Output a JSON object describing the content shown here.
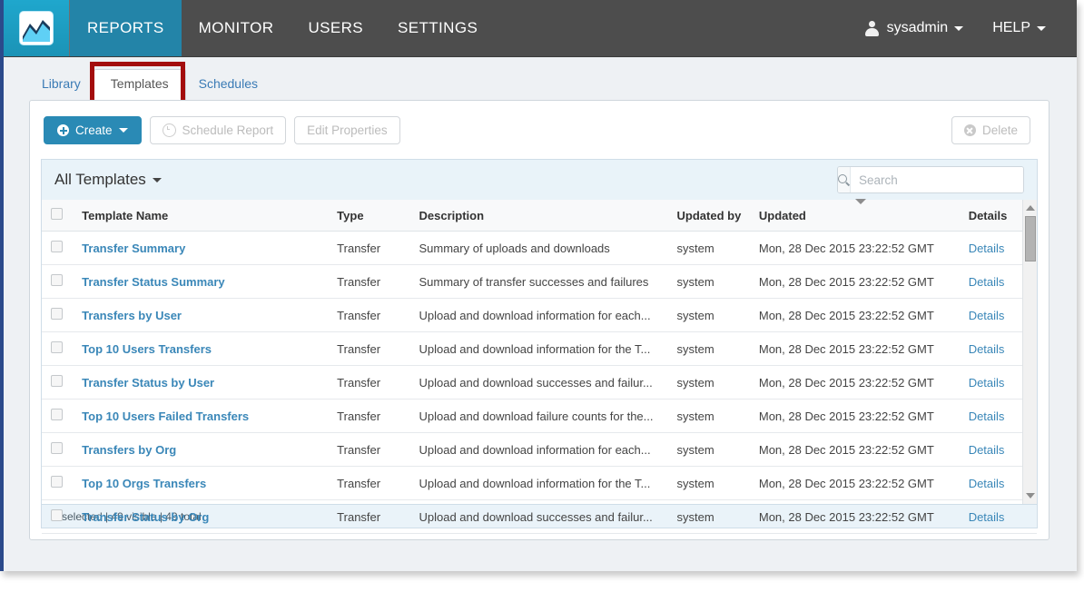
{
  "topnav": {
    "logo_icon": "chart-logo-icon",
    "items": [
      {
        "label": "REPORTS",
        "active": true
      },
      {
        "label": "MONITOR",
        "active": false
      },
      {
        "label": "USERS",
        "active": false
      },
      {
        "label": "SETTINGS",
        "active": false
      }
    ],
    "user": {
      "label": "sysadmin",
      "icon": "user-icon"
    },
    "help": {
      "label": "HELP"
    },
    "active_color": "#2384a8",
    "bar_color": "#4d4d4d"
  },
  "subtabs": {
    "items": [
      {
        "label": "Library",
        "active": false
      },
      {
        "label": "Templates",
        "active": true
      },
      {
        "label": "Schedules",
        "active": false
      }
    ],
    "annotation_color": "#a30d0d"
  },
  "toolbar": {
    "create_label": "Create",
    "schedule_report_label": "Schedule Report",
    "edit_properties_label": "Edit Properties",
    "delete_label": "Delete",
    "primary_color": "#2a8ab5"
  },
  "list_header": {
    "title": "All Templates",
    "search_placeholder": "Search",
    "search_value": ""
  },
  "table": {
    "columns": [
      "Template Name",
      "Type",
      "Description",
      "Updated by",
      "Updated",
      "Details"
    ],
    "sorted_column": "Updated",
    "details_label": "Details",
    "rows": [
      {
        "name": "Transfer Summary",
        "type": "Transfer",
        "description": "Summary of uploads and downloads",
        "updated_by": "system",
        "updated": "Mon, 28 Dec 2015 23:22:52 GMT",
        "details": "Details"
      },
      {
        "name": "Transfer Status Summary",
        "type": "Transfer",
        "description": "Summary of transfer successes and failures",
        "updated_by": "system",
        "updated": "Mon, 28 Dec 2015 23:22:52 GMT",
        "details": "Details"
      },
      {
        "name": "Transfers by User",
        "type": "Transfer",
        "description": "Upload and download information for each...",
        "updated_by": "system",
        "updated": "Mon, 28 Dec 2015 23:22:52 GMT",
        "details": "Details"
      },
      {
        "name": "Top 10 Users Transfers",
        "type": "Transfer",
        "description": "Upload and download information for the T...",
        "updated_by": "system",
        "updated": "Mon, 28 Dec 2015 23:22:52 GMT",
        "details": "Details"
      },
      {
        "name": "Transfer Status by User",
        "type": "Transfer",
        "description": "Upload and download successes and failur...",
        "updated_by": "system",
        "updated": "Mon, 28 Dec 2015 23:22:52 GMT",
        "details": "Details"
      },
      {
        "name": "Top 10 Users Failed Transfers",
        "type": "Transfer",
        "description": "Upload and download failure counts for the...",
        "updated_by": "system",
        "updated": "Mon, 28 Dec 2015 23:22:52 GMT",
        "details": "Details"
      },
      {
        "name": "Transfers by Org",
        "type": "Transfer",
        "description": "Upload and download information for each...",
        "updated_by": "system",
        "updated": "Mon, 28 Dec 2015 23:22:52 GMT",
        "details": "Details"
      },
      {
        "name": "Top 10 Orgs Transfers",
        "type": "Transfer",
        "description": "Upload and download information for the T...",
        "updated_by": "system",
        "updated": "Mon, 28 Dec 2015 23:22:52 GMT",
        "details": "Details"
      },
      {
        "name": "Transfer Status by Org",
        "type": "Transfer",
        "description": "Upload and download successes and failur...",
        "updated_by": "system",
        "updated": "Mon, 28 Dec 2015 23:22:52 GMT",
        "details": "Details"
      }
    ]
  },
  "statusbar": {
    "text": "0 selected | 49 visible | 49 total"
  }
}
